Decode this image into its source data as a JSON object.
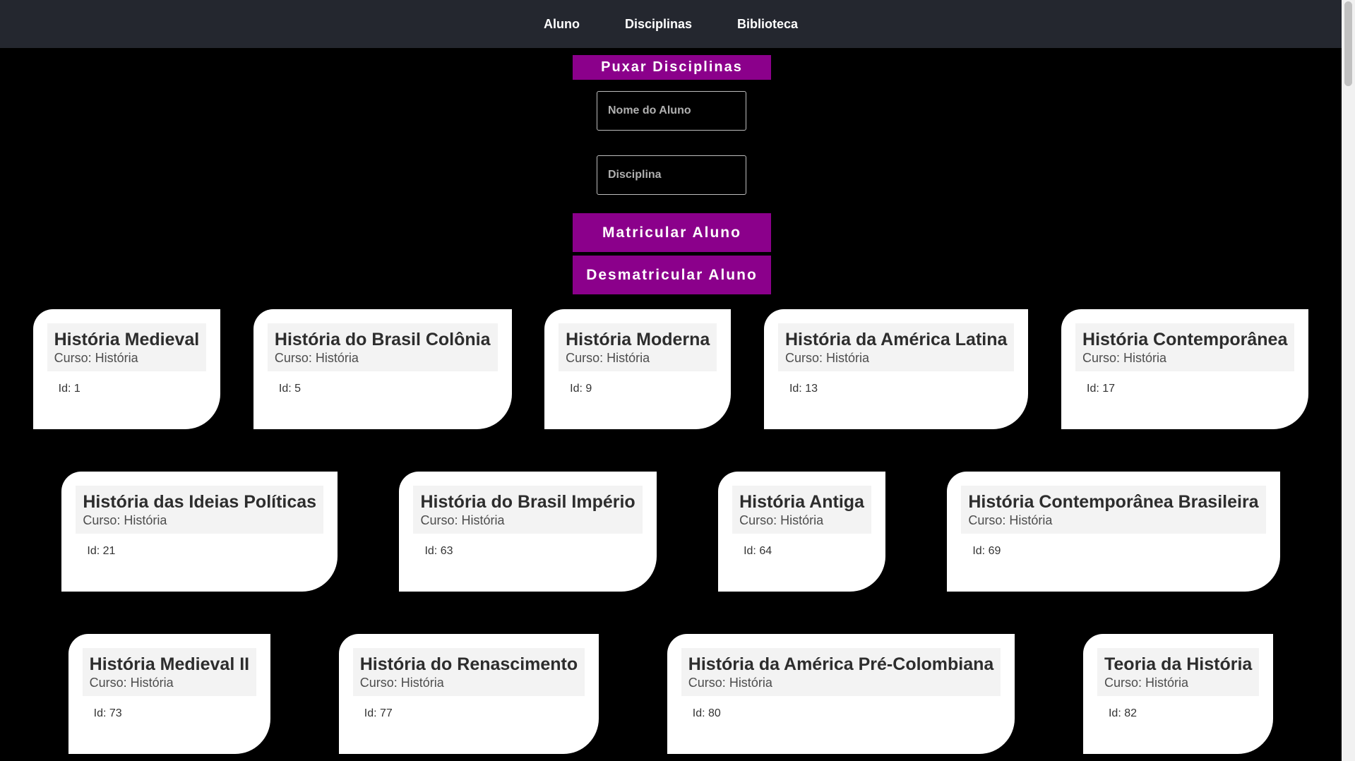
{
  "nav": {
    "items": [
      "Aluno",
      "Disciplinas",
      "Biblioteca"
    ]
  },
  "form": {
    "pull_button": "Puxar Disciplinas",
    "student_name_placeholder": "Nome do Aluno",
    "discipline_placeholder": "Disciplina",
    "enroll_button": "Matricular Aluno",
    "unenroll_button": "Desmatricular Aluno"
  },
  "colors": {
    "navbar": "#24272f",
    "accent_button": "#8b008b",
    "page_background": "#000000",
    "card_background": "#ffffff"
  },
  "cards": [
    {
      "title": "História Medieval",
      "course": "Curso: História",
      "id": "Id: 1"
    },
    {
      "title": "História do Brasil Colônia",
      "course": "Curso: História",
      "id": "Id: 5"
    },
    {
      "title": "História Moderna",
      "course": "Curso: História",
      "id": "Id: 9"
    },
    {
      "title": "História da América Latina",
      "course": "Curso: História",
      "id": "Id: 13"
    },
    {
      "title": "História Contemporânea",
      "course": "Curso: História",
      "id": "Id: 17"
    },
    {
      "title": "História das Ideias Políticas",
      "course": "Curso: História",
      "id": "Id: 21"
    },
    {
      "title": "História do Brasil Império",
      "course": "Curso: História",
      "id": "Id: 63"
    },
    {
      "title": "História Antiga",
      "course": "Curso: História",
      "id": "Id: 64"
    },
    {
      "title": "História Contemporânea Brasileira",
      "course": "Curso: História",
      "id": "Id: 69"
    },
    {
      "title": "História Medieval II",
      "course": "Curso: História",
      "id": "Id: 73"
    },
    {
      "title": "História do Renascimento",
      "course": "Curso: História",
      "id": "Id: 77"
    },
    {
      "title": "História da América Pré-Colombiana",
      "course": "Curso: História",
      "id": "Id: 80"
    },
    {
      "title": "Teoria da História",
      "course": "Curso: História",
      "id": "Id: 82"
    }
  ]
}
